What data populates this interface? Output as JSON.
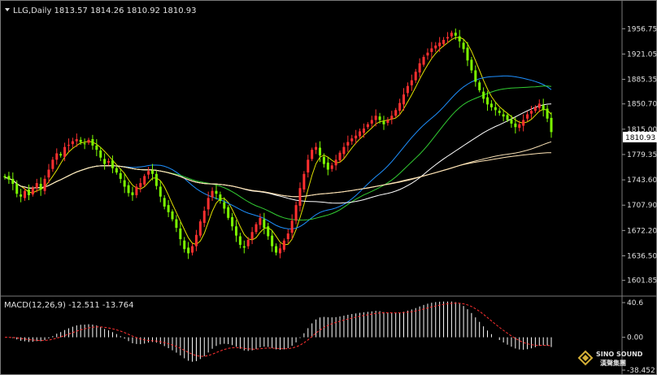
{
  "header": {
    "symbol_line": "LLG,Daily  1813.57 1814.26 1810.92 1810.93"
  },
  "macd_label": "MACD(12,26,9) -12.511 -13.764",
  "price_axis": {
    "ticks": [
      "1956.75",
      "1921.05",
      "1885.35",
      "1850.70",
      "1815.00",
      "1779.35",
      "1743.60",
      "1707.90",
      "1672.20",
      "1636.50",
      "1601.85"
    ],
    "current_price": "1810.93"
  },
  "macd_axis": {
    "ticks": [
      "40.6",
      "0.00",
      "-38.452"
    ]
  },
  "logo": {
    "line1": "SINO SOUND",
    "line2": "漢聲集團"
  },
  "colors": {
    "background": "#000000",
    "up_candle": "#ff3030",
    "down_candle": "#7cfc00",
    "ma_fast": "#e0e000",
    "ma_mid1": "#1e90ff",
    "ma_mid2": "#32cd32",
    "ma_slow1": "#ffffff",
    "ma_slow2": "#f5deb3",
    "ma_slow3": "#ffe4b5",
    "macd_hist": "#ffffff",
    "macd_signal": "#ff3030",
    "price_tag_bg": "#ffffff",
    "price_tag_fg": "#000000"
  },
  "chart_data": {
    "type": "candlestick",
    "ylim": [
      1590,
      1972
    ],
    "close": [
      1747,
      1744,
      1738,
      1724,
      1720,
      1728,
      1722,
      1732,
      1739,
      1730,
      1745,
      1758,
      1772,
      1781,
      1778,
      1790,
      1793,
      1798,
      1801,
      1797,
      1794,
      1800,
      1792,
      1786,
      1775,
      1766,
      1770,
      1760,
      1754,
      1745,
      1734,
      1725,
      1722,
      1734,
      1739,
      1749,
      1756,
      1752,
      1735,
      1720,
      1706,
      1698,
      1688,
      1676,
      1660,
      1646,
      1640,
      1650,
      1666,
      1685,
      1700,
      1718,
      1728,
      1724,
      1714,
      1703,
      1690,
      1678,
      1665,
      1652,
      1648,
      1659,
      1670,
      1681,
      1690,
      1676,
      1664,
      1650,
      1641,
      1647,
      1658,
      1668,
      1686,
      1708,
      1732,
      1752,
      1772,
      1786,
      1790,
      1778,
      1766,
      1758,
      1764,
      1772,
      1782,
      1790,
      1797,
      1802,
      1806,
      1812,
      1816,
      1822,
      1828,
      1834,
      1828,
      1822,
      1828,
      1834,
      1842,
      1852,
      1864,
      1876,
      1884,
      1896,
      1908,
      1917,
      1923,
      1929,
      1933,
      1937,
      1941,
      1945,
      1951,
      1947,
      1939,
      1928,
      1912,
      1898,
      1882,
      1870,
      1858,
      1850,
      1846,
      1842,
      1838,
      1833,
      1828,
      1823,
      1818,
      1822,
      1828,
      1836,
      1841,
      1846,
      1851,
      1842,
      1830,
      1811
    ]
  }
}
